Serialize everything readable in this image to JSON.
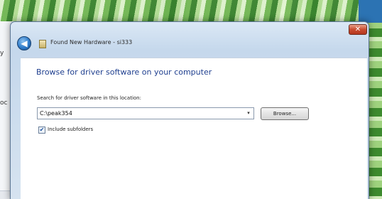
{
  "background_window": {
    "fragment_1": "y",
    "fragment_2": "oc"
  },
  "dialog": {
    "title": "Found New Hardware - si333",
    "close_glyph": "✕",
    "back_glyph": "◀",
    "heading": "Browse for driver software on your computer",
    "search_label": "Search for driver software in this location:",
    "path_value": "C:\\peak354",
    "dropdown_glyph": "▾",
    "browse_label": "Browse...",
    "include_subfolders_label": "Include subfolders",
    "include_subfolders_checked": true,
    "check_glyph": "✔"
  },
  "colors": {
    "heading": "#1f3f8f",
    "close_button": "#c94c31"
  }
}
